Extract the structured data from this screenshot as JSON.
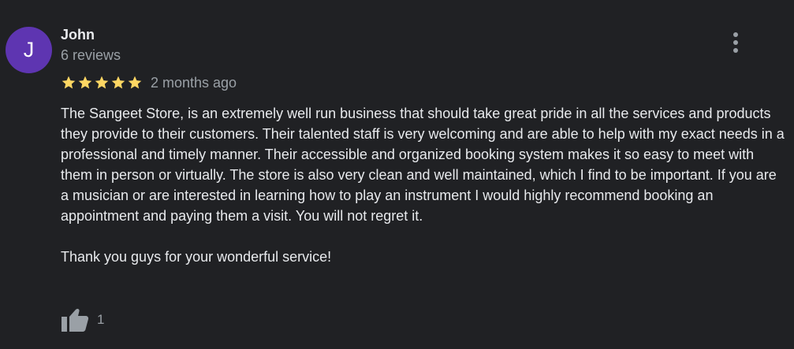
{
  "review": {
    "author": {
      "initial": "J",
      "name": "John",
      "review_count": "6 reviews"
    },
    "rating": 5,
    "date": "2 months ago",
    "paragraphs": [
      "The Sangeet Store, is an extremely well run business that should take great pride in all the services and products they provide to their customers. Their talented staff is very welcoming and are able to help with my exact needs in a professional and timely manner. Their accessible and organized booking system makes it so easy to meet with them in person or virtually. The store is also very clean and well maintained, which I find to be important. If you are a musician or are interested in learning how to play an instrument I would highly recommend booking an appointment and paying them a visit. You will not regret it.",
      "Thank you guys for your wonderful service!"
    ],
    "likes": "1"
  },
  "icons": {
    "more": "more-vertical-icon",
    "star": "star-icon",
    "like": "thumbs-up-icon"
  },
  "colors": {
    "background": "#202124",
    "avatar": "#5e35b1",
    "star": "#fdd663",
    "primary_text": "#e8eaed",
    "secondary_text": "#9aa0a6"
  }
}
